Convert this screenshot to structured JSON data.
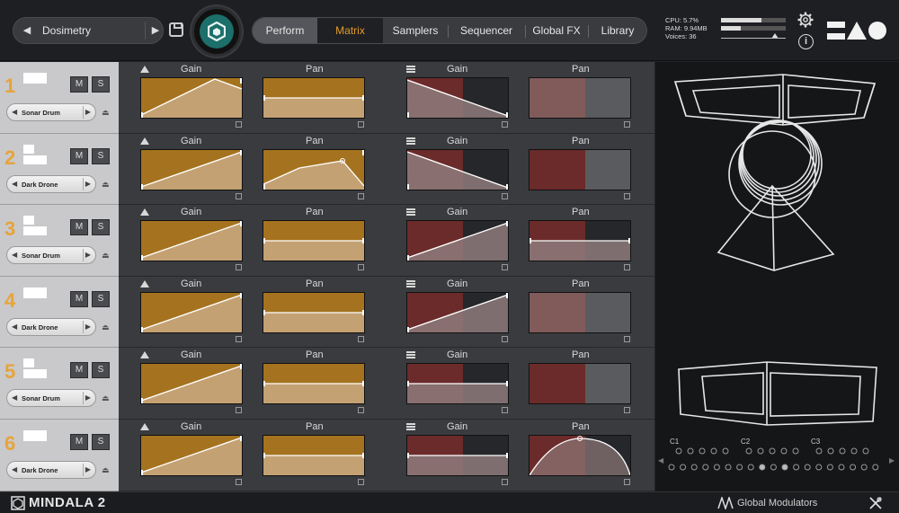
{
  "header": {
    "preset_name": "Dosimetry",
    "prev_glyph": "◀",
    "next_glyph": "▶",
    "tabs": {
      "perform": "Perform",
      "matrix": "Matrix",
      "samplers": "Samplers",
      "sequencer": "Sequencer",
      "global_fx": "Global FX",
      "library": "Library"
    },
    "active_tab": "Matrix",
    "stats": {
      "cpu": "CPU: 5.7%",
      "ram": "RAM: 9.94MB",
      "voices": "Voices: 36"
    },
    "meter_level_1": 0.62,
    "meter_level_2": 0.3,
    "info_glyph": "i"
  },
  "rows": [
    {
      "num": "1",
      "sample": "Sonar Drum",
      "gain_l": "Gain",
      "pan_l": "Pan",
      "gain_r": "Gain",
      "pan_r": "Pan"
    },
    {
      "num": "2",
      "sample": "Dark Drone",
      "gain_l": "Gain",
      "pan_l": "Pan",
      "gain_r": "Gain",
      "pan_r": "Pan"
    },
    {
      "num": "3",
      "sample": "Sonar Drum",
      "gain_l": "Gain",
      "pan_l": "Pan",
      "gain_r": "Gain",
      "pan_r": "Pan"
    },
    {
      "num": "4",
      "sample": "Dark Drone",
      "gain_l": "Gain",
      "pan_l": "Pan",
      "gain_r": "Gain",
      "pan_r": "Pan"
    },
    {
      "num": "5",
      "sample": "Sonar Drum",
      "gain_l": "Gain",
      "pan_l": "Pan",
      "gain_r": "Gain",
      "pan_r": "Pan"
    },
    {
      "num": "6",
      "sample": "Dark Drone",
      "gain_l": "Gain",
      "pan_l": "Pan",
      "gain_r": "Gain",
      "pan_r": "Pan"
    }
  ],
  "buttons": {
    "mute": "M",
    "solo": "S",
    "arrow_left": "◀",
    "arrow_right": "▶",
    "eject": "⏏"
  },
  "controllers": {
    "c1": "C1",
    "c2": "C2",
    "c3": "C3",
    "nav_left": "◀",
    "nav_right": "▶"
  },
  "footer": {
    "app_name": "MINDALA 2",
    "global_modulators": "Global Modulators"
  },
  "colors": {
    "accent": "#e29a2b",
    "orange_panel": "#a5731f",
    "red_panel": "#6b2b2a",
    "teal": "#1c6f6a"
  }
}
